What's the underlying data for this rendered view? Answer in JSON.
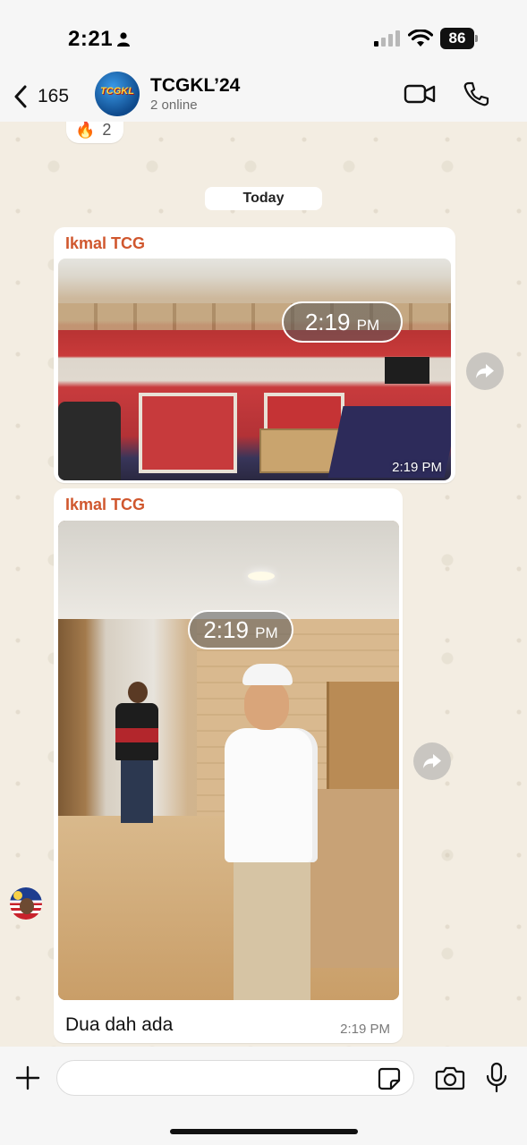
{
  "status_bar": {
    "time": "2:21",
    "battery": "86"
  },
  "header": {
    "back_count": "165",
    "title": "TCGKL’24",
    "subtitle": "2 online",
    "avatar_logo_text": "TCGKL"
  },
  "chat": {
    "reaction": {
      "emoji": "🔥",
      "count": "2"
    },
    "date_separator": "Today",
    "messages": [
      {
        "sender": "Ikmal TCG",
        "overlay_time": "2:19",
        "overlay_ampm": "PM",
        "photo_time": "2:19 PM"
      },
      {
        "sender": "Ikmal TCG",
        "overlay_time": "2:19",
        "overlay_ampm": "PM",
        "caption": "Dua dah ada",
        "time": "2:19 PM"
      }
    ]
  },
  "input_bar": {
    "placeholder": ""
  },
  "colors": {
    "sender_name": "#d0572e",
    "background": "#f4efe6",
    "bubble": "#ffffff"
  },
  "icons": {
    "back": "chevron-left-icon",
    "video": "video-camera-icon",
    "call": "phone-icon",
    "forward": "forward-arrow-icon",
    "plus": "plus-icon",
    "sticker": "sticker-icon",
    "camera": "camera-icon",
    "mic": "microphone-icon"
  }
}
